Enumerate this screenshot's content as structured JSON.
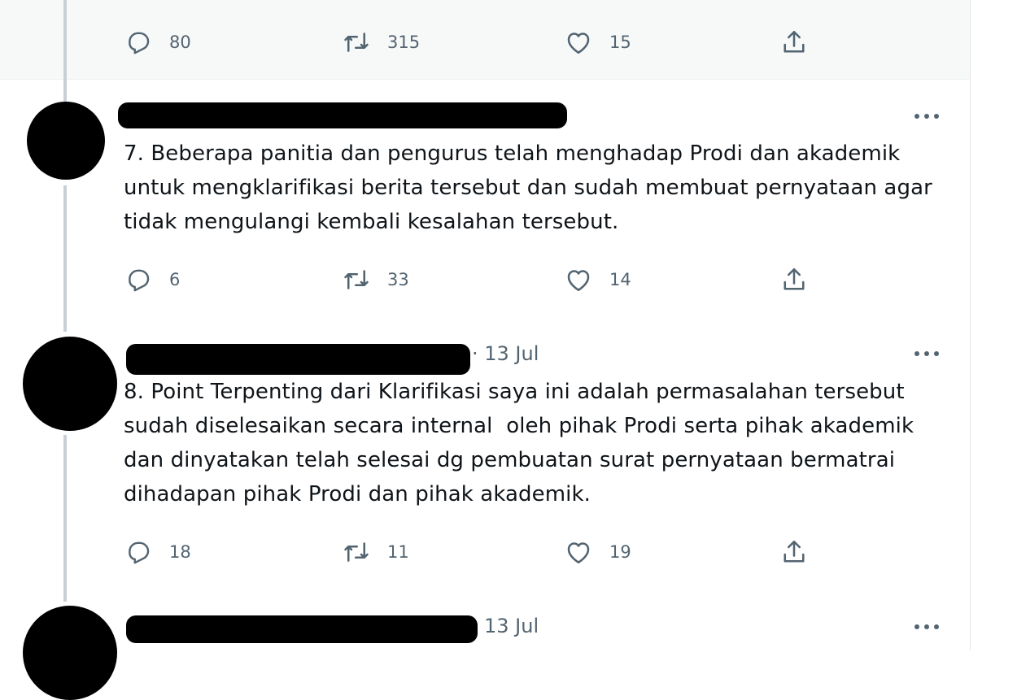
{
  "tweets": [
    {
      "text": "",
      "stats": {
        "replies": "80",
        "retweets": "315",
        "likes": "15"
      }
    },
    {
      "text": "7. Beberapa panitia dan pengurus telah menghadap Prodi dan akademik\nuntuk mengklarifikasi berita tersebut dan sudah membuat pernyataan agar\ntidak mengulangi kembali kesalahan tersebut.",
      "stats": {
        "replies": "6",
        "retweets": "33",
        "likes": "14"
      }
    },
    {
      "date": "· 13 Jul",
      "text": "8. Point Terpenting dari Klarifikasi saya ini adalah permasalahan tersebut\nsudah diselesaikan secara internal  oleh pihak Prodi serta pihak akademik\ndan dinyatakan telah selesai dg pembuatan surat pernyataan bermatrai\ndihadapan pihak Prodi dan pihak akademik.",
      "stats": {
        "replies": "18",
        "retweets": "11",
        "likes": "19"
      }
    },
    {
      "date": "13 Jul"
    }
  ],
  "icons": {
    "reply": "reply-icon",
    "retweet": "retweet-icon",
    "like": "like-icon",
    "share": "share-icon",
    "more": "more-options-icon"
  },
  "colors": {
    "text": "#0f1419",
    "muted": "#536471",
    "thread_line": "#c8d0d6",
    "highlight_bg": "#f7f9f9"
  }
}
